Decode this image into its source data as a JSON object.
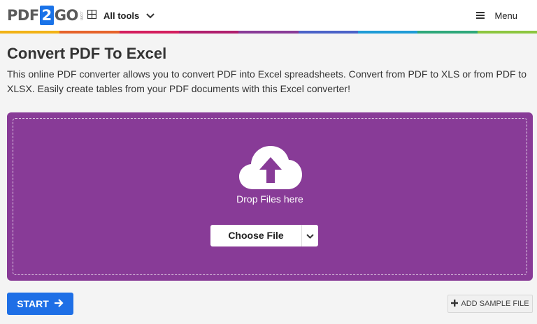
{
  "header": {
    "logo": {
      "part1": "PDF",
      "part2": "2",
      "part3": "GO",
      "suffix": ".com"
    },
    "all_tools_label": "All tools",
    "menu_label": "Menu",
    "rainbow_colors": [
      "#f2b316",
      "#e6632a",
      "#d41e5e",
      "#b01f6e",
      "#883b97",
      "#4a62c8",
      "#1e9bd6",
      "#2fa87a",
      "#8cc63f"
    ]
  },
  "page": {
    "title": "Convert PDF To Excel",
    "description": "This online PDF converter allows you to convert PDF into Excel spreadsheets. Convert from PDF to XLS or from PDF to XLSX. Easily create tables from your PDF documents with this Excel converter!"
  },
  "dropzone": {
    "drop_text": "Drop Files here",
    "choose_label": "Choose File",
    "color": "#883b97"
  },
  "actions": {
    "start_label": "START",
    "sample_label": "ADD SAMPLE FILE",
    "start_color": "#1e6fe6"
  }
}
